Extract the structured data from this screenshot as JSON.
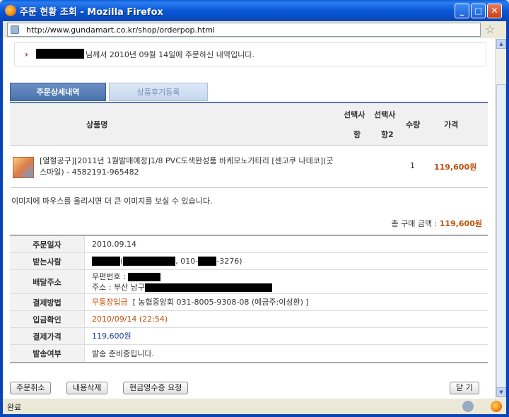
{
  "window": {
    "title": "주문 현황 조회 - Mozilla Firefox",
    "min": "_",
    "max": "□",
    "close": "✕"
  },
  "address": {
    "url": "http://www.gundamart.co.kr/shop/orderpop.html"
  },
  "notice": {
    "arrow": "›",
    "text": "님께서 2010년 09월 14일에 주문하신 내역입니다."
  },
  "tabs": [
    {
      "label": "주문상세내역"
    },
    {
      "label": "상품후기등록"
    }
  ],
  "product_table": {
    "headers": {
      "name": "상품명",
      "opt1a": "선택사",
      "opt1b": "항",
      "opt2a": "선택사",
      "opt2b": "항2",
      "qty": "수량",
      "price": "가격"
    },
    "rows": [
      {
        "name": "[열혈공구][2011년 1월발매예정]1/8 PVC도색완성품 바케모노가타리 [센고쿠 나데코](굿스마일) - 4582191-965482",
        "qty": "1",
        "price": "119,600원"
      }
    ]
  },
  "hover_note": "이미지에 마우스를 올리시면 더 큰 이미지를 보실 수 있습니다.",
  "total": {
    "label": "총 구매 금액 : ",
    "value": "119,600원"
  },
  "info": {
    "order_date": {
      "label": "주문일자",
      "value": "2010.09.14"
    },
    "recipient": {
      "label": "받는사람",
      "p1": "(",
      "p2": ", 010-",
      "p3": "-3276)"
    },
    "address": {
      "label": "배달주소",
      "zip": "우편번호 :",
      "addr": "주소 : 부산 남구"
    },
    "payment": {
      "label": "결제방법",
      "method": "무통장입금",
      "bank": "[ 농협중앙회 031-8005-9308-08 (예금주:이성환) ]"
    },
    "deposit": {
      "label": "입금확인",
      "value": "2010/09/14 (22:54)"
    },
    "amount": {
      "label": "결제가격",
      "value": "119,600원"
    },
    "shipping": {
      "label": "발송여부",
      "value": "발송 준비중입니다."
    }
  },
  "buttons": {
    "cancel": "주문취소",
    "delete": "내용삭제",
    "receipt": "현금영수증 요청",
    "close": "닫 기"
  },
  "status": {
    "text": "완료"
  },
  "colors": {
    "accent": "#0846b8",
    "price": "#c0500a",
    "tab_active": "#4a73ae"
  }
}
